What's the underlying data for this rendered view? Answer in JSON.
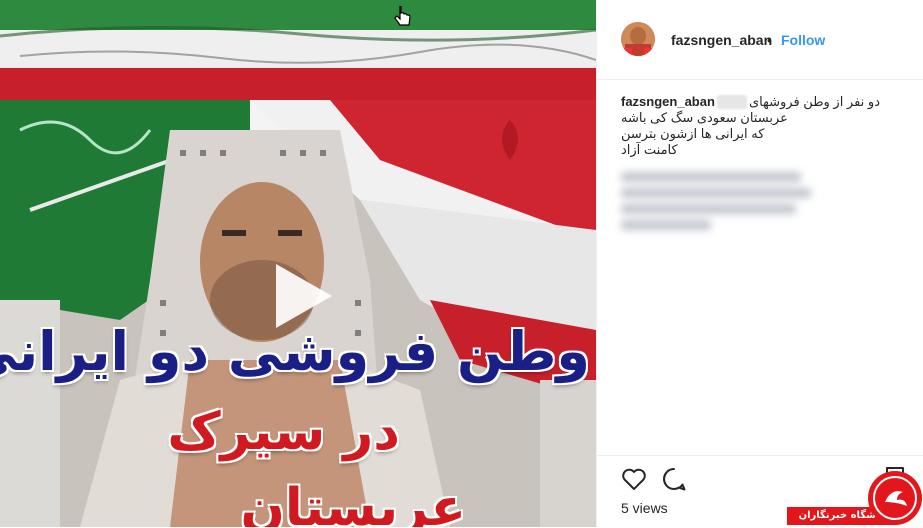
{
  "post": {
    "username": "fazsngen_aban",
    "separator": "•",
    "follow_label": "Follow",
    "views_label": "5 views"
  },
  "media": {
    "overlay_line1": "وطن فروشی دو ایرانی",
    "overlay_line2": "در سیرک",
    "overlay_line3": "عربستان",
    "play_icon": "play-icon"
  },
  "caption": {
    "username": "fazsngen_aban",
    "line1": "دو نفر از وطن فروشهای",
    "line2": "عربستان سعودی سگ کی باشه",
    "line3": "که ایرانی ها ازشون بترسن",
    "line4": "کامنت آزاد"
  },
  "watermark": {
    "label": "باشگاه خبرنگاران"
  },
  "colors": {
    "follow": "#3897f0",
    "text": "#262626",
    "border": "#efefef",
    "overlay_blue": "#1a1f86",
    "overlay_red": "#d11a1f",
    "watermark_red": "#e3161b"
  },
  "icons": [
    "heart-icon",
    "comment-icon",
    "bookmark-icon",
    "cursor-icon",
    "play-icon"
  ]
}
